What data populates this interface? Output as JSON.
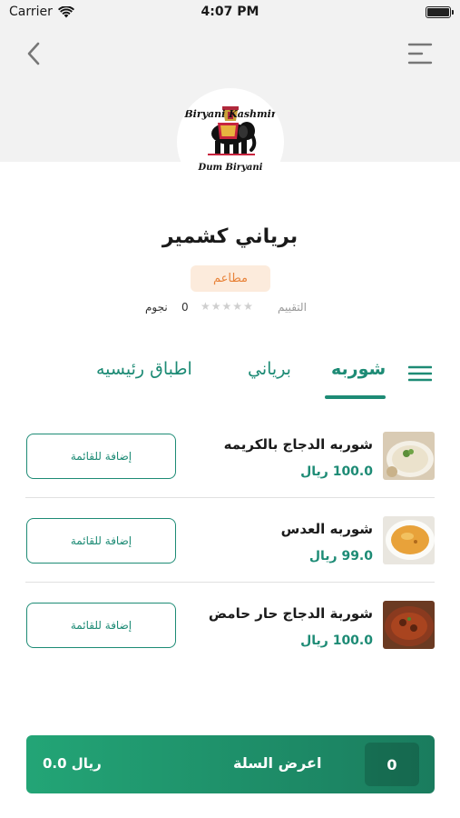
{
  "status_bar": {
    "carrier": "Carrier",
    "time": "4:07 PM"
  },
  "logo": {
    "top_text": "Biryani Kashmir",
    "bottom_text": "Dum Biryani"
  },
  "restaurant": {
    "name": "برياني كشمير",
    "category": "مطاعم",
    "rating_label": "التقييم",
    "rating_value": "0",
    "rating_unit": "نجوم",
    "rating_stars": 0
  },
  "tabs": [
    {
      "label": "شوربه",
      "active": true
    },
    {
      "label": "برياني",
      "active": false
    },
    {
      "label": "اطباق رئيسيه",
      "active": false
    }
  ],
  "menu_items": [
    {
      "name": "شوربه الدجاج بالكريمه",
      "price": "100.0 ريال",
      "button": "إضافة للقائمة",
      "image": "creamy-chicken-soup"
    },
    {
      "name": "شوربه العدس",
      "price": "99.0 ريال",
      "button": "إضافة للقائمة",
      "image": "lentil-soup"
    },
    {
      "name": "شوربة الدجاج حار حامض",
      "price": "100.0 ريال",
      "button": "إضافة للقائمة",
      "image": "hot-sour-chicken-soup"
    }
  ],
  "cart": {
    "label": "اعرض السلة",
    "count": "0",
    "total": "0.0 ريال"
  },
  "colors": {
    "accent": "#1d8b75",
    "badge_bg": "#fcebdc",
    "badge_text": "#e8833a",
    "cart_start": "#23a576",
    "cart_end": "#1a7c5e"
  },
  "icons": [
    "wifi-icon",
    "battery-icon",
    "back-chevron-icon",
    "hamburger-menu-icon",
    "list-menu-icon",
    "star-icon"
  ]
}
